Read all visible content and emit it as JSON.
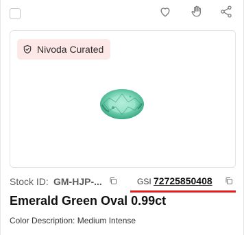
{
  "badge": {
    "label": "Nivoda Curated",
    "background": "#fde7e7"
  },
  "stock": {
    "label": "Stock ID:",
    "value": "GM-HJP-..."
  },
  "gsi": {
    "label": "GSI",
    "number": "72725850408",
    "underline_color": "#e11d1d"
  },
  "product": {
    "title": "Emerald Green Oval 0.99ct",
    "color_description": "Color Description: Medium Intense"
  },
  "icons": [
    "checkbox",
    "heart-icon",
    "hand-icon",
    "share-icon",
    "shield-check-icon",
    "copy-icon"
  ]
}
